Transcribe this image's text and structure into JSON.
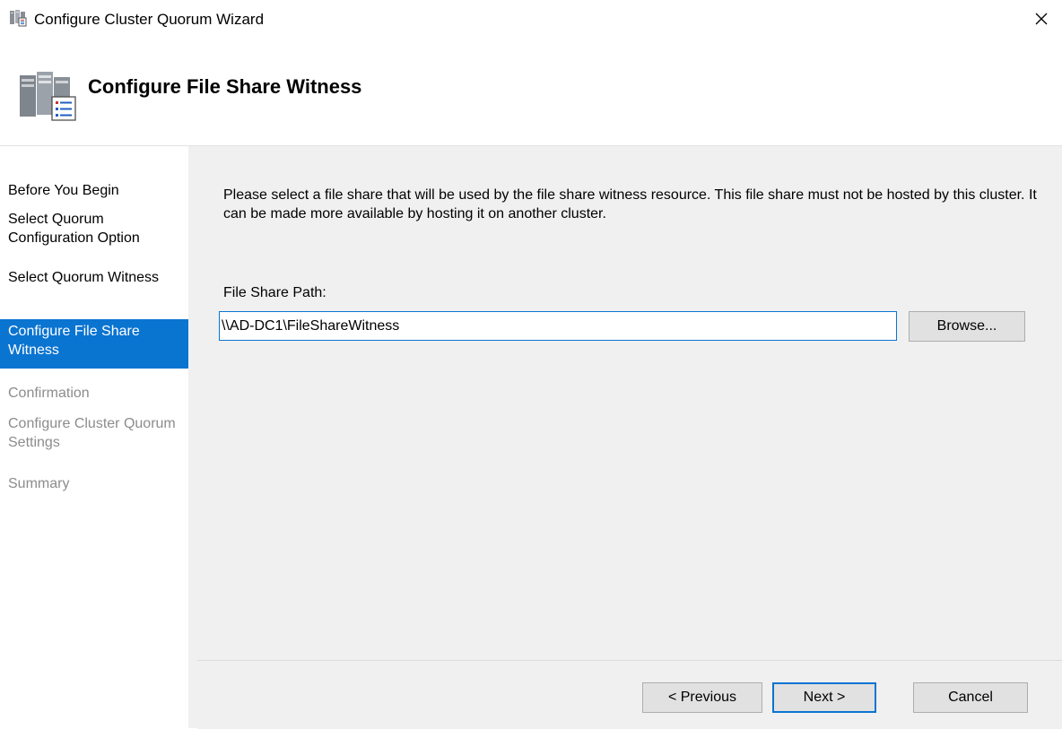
{
  "window": {
    "title": "Configure Cluster Quorum Wizard"
  },
  "header": {
    "title": "Configure File Share Witness"
  },
  "sidebar": {
    "steps": [
      {
        "label": "Before You Begin",
        "state": "done"
      },
      {
        "label": "Select Quorum Configuration Option",
        "state": "done"
      },
      {
        "label": "Select Quorum Witness",
        "state": "done"
      },
      {
        "label": "Configure File Share Witness",
        "state": "active"
      },
      {
        "label": "Confirmation",
        "state": "pending"
      },
      {
        "label": "Configure Cluster Quorum Settings",
        "state": "pending"
      },
      {
        "label": "Summary",
        "state": "pending"
      }
    ]
  },
  "main": {
    "description": "Please select a file share that will be used by the file share witness resource.  This file share must not be hosted by this cluster.  It can be made more available by hosting it on another cluster.",
    "path_label": "File Share Path:",
    "path_value": "\\\\AD-DC1\\FileShareWitness",
    "browse_label": "Browse..."
  },
  "footer": {
    "previous_label": "< Previous",
    "next_label": "Next >",
    "cancel_label": "Cancel"
  },
  "colors": {
    "accent": "#0a74d1",
    "panel": "#f0f0f0",
    "disabled_text": "#8c8c8c"
  },
  "icons": {
    "title": "cluster-servers-icon",
    "header": "cluster-servers-icon",
    "close": "close-icon"
  }
}
